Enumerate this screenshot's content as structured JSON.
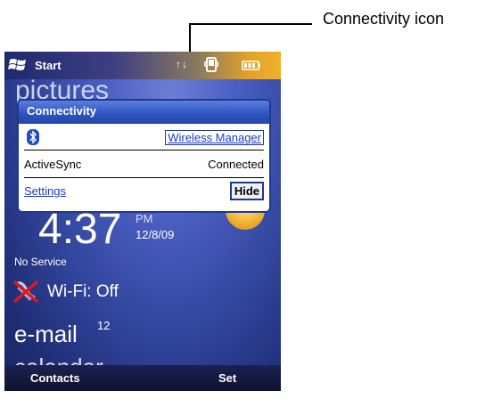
{
  "annotation": {
    "label": "Connectivity icon"
  },
  "topbar": {
    "start_label": "Start",
    "status_arrows": "↑↓"
  },
  "background_items": {
    "pictures": "pictures"
  },
  "popup": {
    "title": "Connectivity",
    "wireless_manager_link": "Wireless Manager",
    "activesync_label": "ActiveSync",
    "activesync_status": "Connected",
    "settings_link": "Settings",
    "hide_button": "Hide"
  },
  "clock": {
    "time": "4:37",
    "ampm": "PM",
    "date": "12/8/09"
  },
  "status": {
    "no_service": "No Service"
  },
  "wifi": {
    "label": "Wi-Fi: Off"
  },
  "email": {
    "label": "e-mail",
    "count": "12"
  },
  "calendar": {
    "label": "calendar"
  },
  "softkeys": {
    "left": "Contacts",
    "right": "Set"
  },
  "colors": {
    "popup_border": "#1d3a8c",
    "popup_title": "#2f55bf",
    "link": "#1a3cc8",
    "screen_bg": "#33479f"
  },
  "icons": [
    "windows-flag-icon",
    "connectivity-icon",
    "battery-icon",
    "bluetooth-icon",
    "wifi-off-icon"
  ]
}
